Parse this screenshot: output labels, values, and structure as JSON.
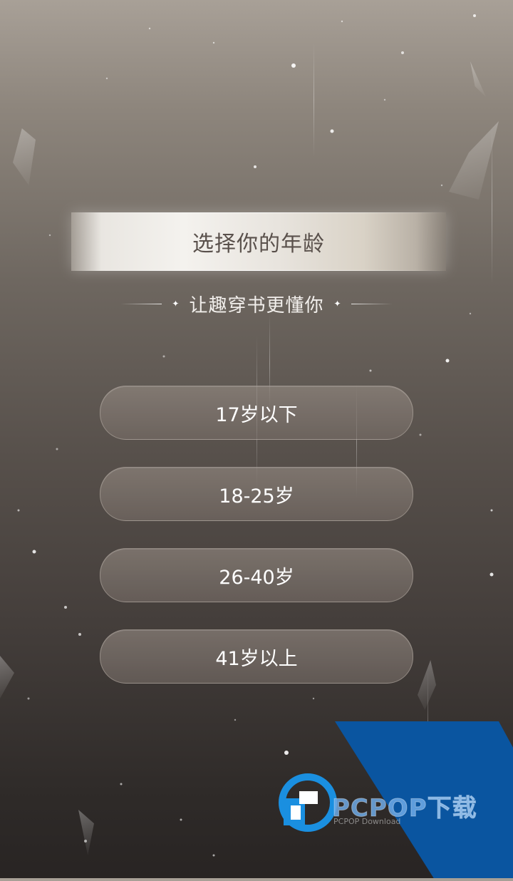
{
  "page": {
    "title": "选择你的年龄",
    "subtitle": "让趣穿书更懂你"
  },
  "options": [
    {
      "label": "17岁以下"
    },
    {
      "label": "18-25岁"
    },
    {
      "label": "26-40岁"
    },
    {
      "label": "41岁以上"
    }
  ],
  "watermark": {
    "brand": "PCPOP下载",
    "sub": "PCPOP Download"
  },
  "colors": {
    "title_text": "#5a514c",
    "button_text": "#ffffff",
    "watermark_blue": "#0a55a0"
  }
}
